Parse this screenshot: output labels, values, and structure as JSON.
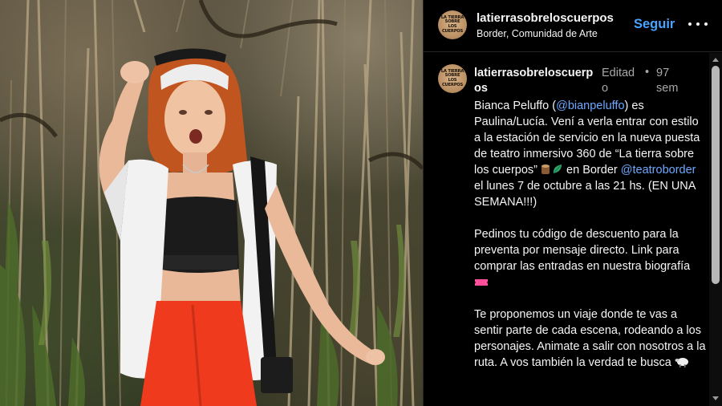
{
  "header": {
    "username": "latierrasobreloscuerpos",
    "location": "Border, Comunidad de Arte",
    "follow_label": "Seguir",
    "avatar_text": "LA TIERRA SOBRE LOS CUERPOS",
    "more_icon": "more-horizontal-icon"
  },
  "comment": {
    "username": "latierrasobreloscuerpos",
    "edited_label": "Editado",
    "separator": "•",
    "time": "97 sem",
    "caption": {
      "p1_a": "Bianca Peluffo (",
      "mention1": "@bianpeluffo",
      "p1_b": ") es Paulina/Lucía. Vení a verla entrar con estilo a la estación de servicio en la nueva puesta de teatro inmersivo 360 de “La tierra sobre los cuerpos” ",
      "p1_c": " en Border ",
      "mention2": "@teatroborder",
      "p1_d": " el lunes 7 de octubre a las 21 hs. (EN UNA SEMANA!!!)",
      "p2": "Pedinos tu código de descuento para la preventa por mensaje directo. Link para comprar las entradas en nuestra biografía ",
      "p3": "Te proponemos un viaje donde te vas a sentir parte de cada escena, rodeando a los personajes. Animate a salir con nosotros a la ruta. A vos también la verdad te busca "
    },
    "emojis": [
      "log-emoji",
      "leaf-emoji",
      "ticket-emoji",
      "sheep-emoji"
    ]
  },
  "colors": {
    "background": "#000000",
    "link": "#4aa3ff",
    "mention": "#6ea8ff",
    "muted": "#a8a8a8"
  }
}
